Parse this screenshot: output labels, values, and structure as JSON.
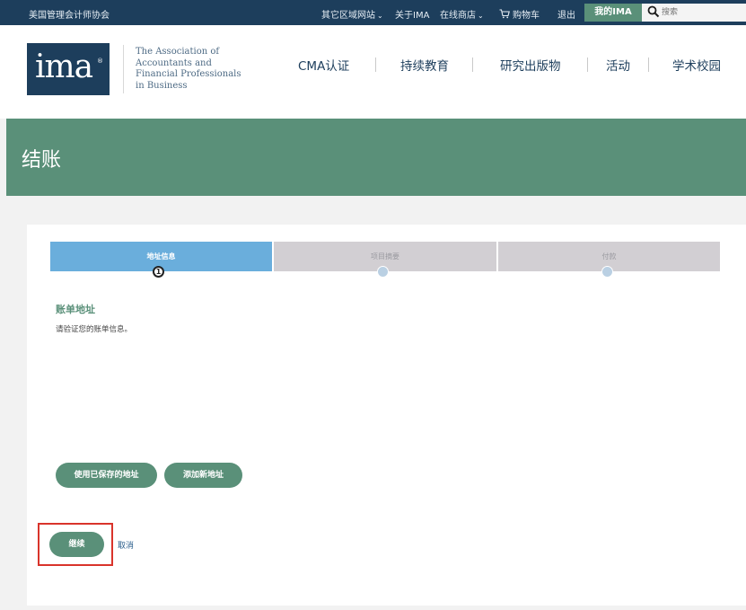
{
  "topbar": {
    "org_name": "美国管理会计师协会",
    "links": [
      {
        "label": "其它区域网站",
        "caret": "⌄"
      },
      {
        "label": "关于IMA",
        "caret": ""
      },
      {
        "label": "在线商店",
        "caret": "⌄"
      },
      {
        "label": "购物车",
        "caret": ""
      },
      {
        "label": "退出",
        "caret": ""
      }
    ],
    "my_ima": "我的IMA",
    "search_placeholder": "搜索"
  },
  "header": {
    "logo_text": "ima",
    "logo_mark": "®",
    "tagline": [
      "The Association of",
      "Accountants and",
      "Financial Professionals",
      "in Business"
    ],
    "nav": [
      "CMA认证",
      "持续教育",
      "研究出版物",
      "活动",
      "学术校园"
    ]
  },
  "banner": {
    "title": "结账"
  },
  "steps": [
    {
      "label": "地址信息",
      "number": "1",
      "state": "active"
    },
    {
      "label": "项目摘要",
      "number": "",
      "state": "inactive"
    },
    {
      "label": "付款",
      "number": "",
      "state": "inactive"
    }
  ],
  "billing": {
    "title": "账单地址",
    "description": "请验证您的账单信息。"
  },
  "buttons": {
    "use_saved": "使用已保存的地址",
    "add_new": "添加新地址",
    "continue": "继续",
    "cancel": "取消"
  },
  "colors": {
    "navy": "#1d3e5c",
    "green": "#5a9079",
    "step_active": "#6aaedc",
    "step_inactive": "#d2cfd3",
    "highlight": "#d9342b"
  }
}
